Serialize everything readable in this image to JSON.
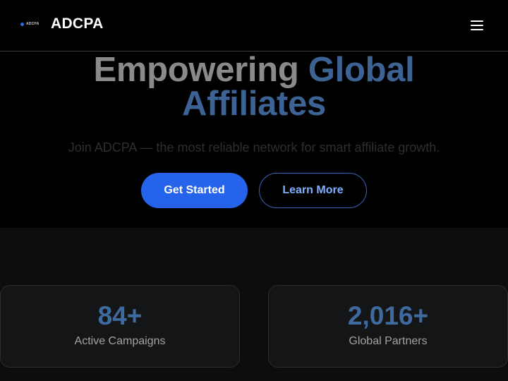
{
  "header": {
    "logo_mark_text": "ADCPA",
    "brand": "ADCPA",
    "menu_icon": "hamburger-icon"
  },
  "hero": {
    "title_part1": "Empowering",
    "title_part2": "Global",
    "title_part3": "Affiliates",
    "subtitle": "Join ADCPA — the most reliable network for smart affiliate growth.",
    "primary_button": "Get Started",
    "secondary_button": "Learn More"
  },
  "stats": [
    {
      "value": "84+",
      "label": "Active Campaigns"
    },
    {
      "value": "2,016+",
      "label": "Global Partners"
    }
  ],
  "colors": {
    "accent": "#2563eb",
    "title_accent": "#3d6294",
    "background": "#000000"
  }
}
